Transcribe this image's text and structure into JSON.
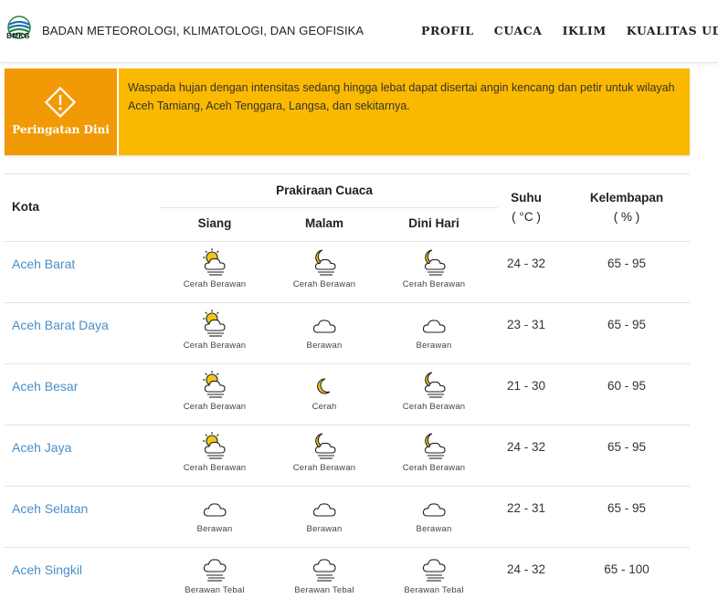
{
  "header": {
    "logo_text": "BMKG",
    "title": "BADAN METEOROLOGI, KLIMATOLOGI, DAN GEOFISIKA",
    "nav": [
      "PROFIL",
      "CUACA",
      "IKLIM",
      "KUALITAS UDARA"
    ]
  },
  "alert": {
    "label": "Peringatan Dini",
    "text": "Waspada hujan dengan intensitas sedang hingga lebat dapat disertai angin kencang dan petir untuk wilayah Aceh Tamiang, Aceh Tenggara, Langsa, dan sekitarnya.",
    "colors": {
      "main": "#fbb900",
      "side": "#f29a05"
    }
  },
  "table": {
    "col_kota": "Kota",
    "col_prakiraan": "Prakiraan Cuaca",
    "col_siang": "Siang",
    "col_malam": "Malam",
    "col_dini": "Dini Hari",
    "col_suhu": "Suhu",
    "col_suhu_unit": "( °C )",
    "col_lembap": "Kelembapan",
    "col_lembap_unit": "( % )",
    "rows": [
      {
        "city": "Aceh Barat",
        "siang": {
          "icon": "sun-cloud-icon",
          "label": "Cerah Berawan"
        },
        "malam": {
          "icon": "moon-cloud-icon",
          "label": "Cerah Berawan"
        },
        "dini": {
          "icon": "moon-cloud-icon",
          "label": "Cerah Berawan"
        },
        "suhu": "24 - 32",
        "lembap": "65 - 95"
      },
      {
        "city": "Aceh Barat Daya",
        "siang": {
          "icon": "sun-cloud-icon",
          "label": "Cerah Berawan"
        },
        "malam": {
          "icon": "cloud-icon",
          "label": "Berawan"
        },
        "dini": {
          "icon": "cloud-icon",
          "label": "Berawan"
        },
        "suhu": "23 - 31",
        "lembap": "65 - 95"
      },
      {
        "city": "Aceh Besar",
        "siang": {
          "icon": "sun-cloud-icon",
          "label": "Cerah Berawan"
        },
        "malam": {
          "icon": "moon-icon",
          "label": "Cerah"
        },
        "dini": {
          "icon": "moon-cloud-icon",
          "label": "Cerah Berawan"
        },
        "suhu": "21 - 30",
        "lembap": "60 - 95"
      },
      {
        "city": "Aceh Jaya",
        "siang": {
          "icon": "sun-cloud-icon",
          "label": "Cerah Berawan"
        },
        "malam": {
          "icon": "moon-cloud-icon",
          "label": "Cerah Berawan"
        },
        "dini": {
          "icon": "moon-cloud-icon",
          "label": "Cerah Berawan"
        },
        "suhu": "24 - 32",
        "lembap": "65 - 95"
      },
      {
        "city": "Aceh Selatan",
        "siang": {
          "icon": "cloud-icon",
          "label": "Berawan"
        },
        "malam": {
          "icon": "cloud-icon",
          "label": "Berawan"
        },
        "dini": {
          "icon": "cloud-icon",
          "label": "Berawan"
        },
        "suhu": "22 - 31",
        "lembap": "65 - 95"
      },
      {
        "city": "Aceh Singkil",
        "siang": {
          "icon": "heavy-cloud-icon",
          "label": "Berawan Tebal"
        },
        "malam": {
          "icon": "heavy-cloud-icon",
          "label": "Berawan Tebal"
        },
        "dini": {
          "icon": "heavy-cloud-icon",
          "label": "Berawan Tebal"
        },
        "suhu": "24 - 32",
        "lembap": "65 - 100"
      }
    ]
  }
}
